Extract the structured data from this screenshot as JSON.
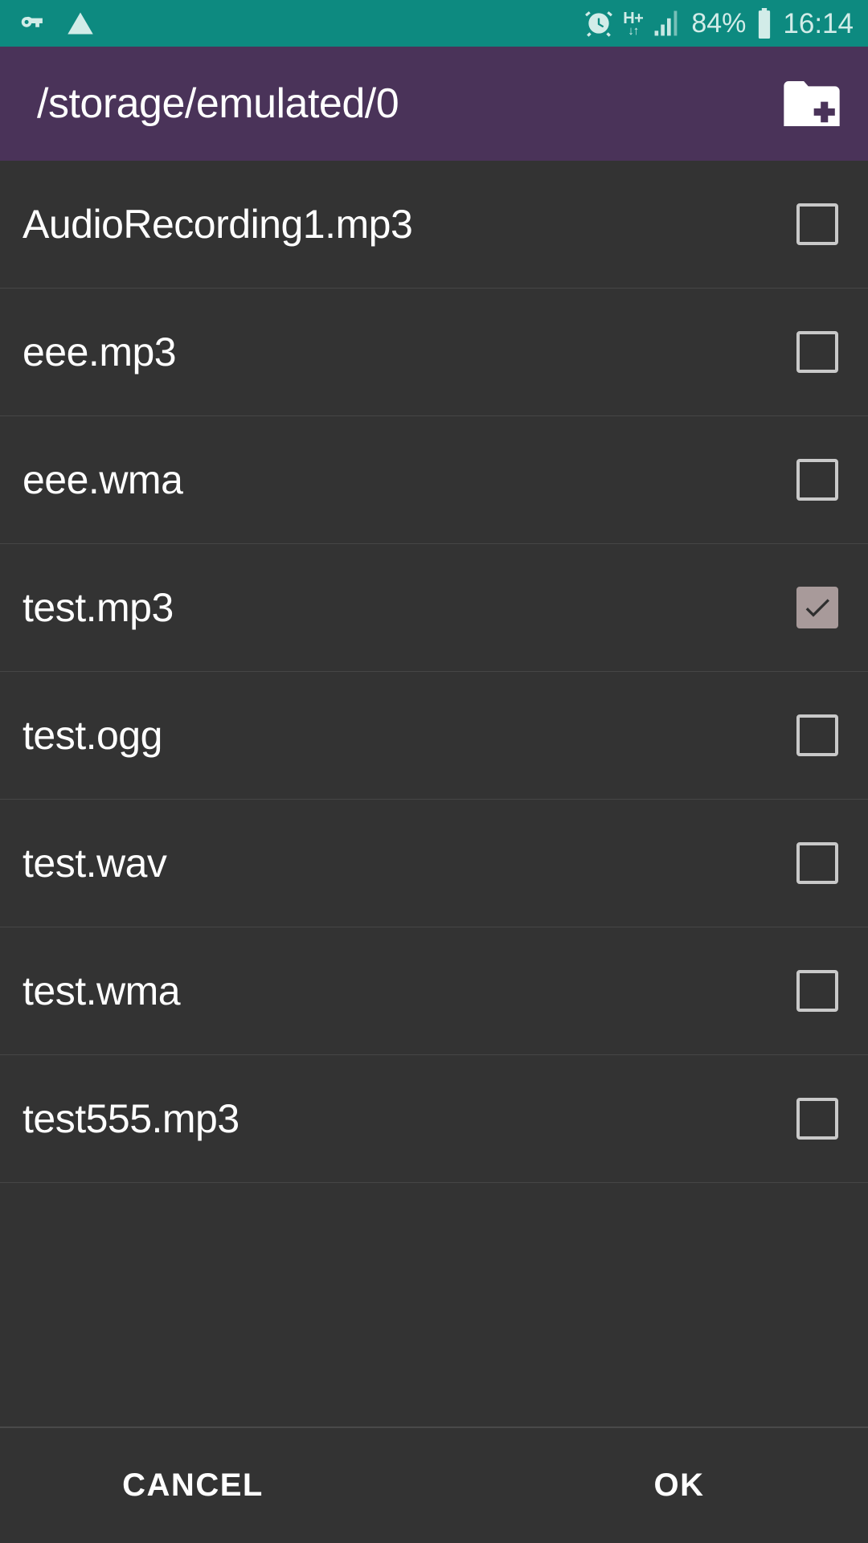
{
  "status_bar": {
    "background_color": "#0d8a80",
    "foreground_color": "#d2ece8",
    "left_icons": [
      {
        "name": "vpn-key-icon",
        "label": "VPN key"
      },
      {
        "name": "warning-triangle-icon",
        "label": "Warning"
      }
    ],
    "alarm_icon": "alarm-clock-icon",
    "network_type": "H+",
    "data_arrows": "↓↑",
    "signal_icon": "signal-bars-icon",
    "battery_percent": "84%",
    "battery_icon": "battery-icon",
    "clock": "16:14"
  },
  "header": {
    "background_color": "#4a3359",
    "path": "/storage/emulated/0",
    "action_icon": "create-new-folder-icon",
    "action_label": "Create new folder"
  },
  "file_list": {
    "background_color": "#333333",
    "divider_color": "#464646",
    "checkbox_checked_color": "#a89a9a",
    "checkbox_unchecked_color": "#c9c9c9",
    "items": [
      {
        "name": "AudioRecording1.mp3",
        "checked": false
      },
      {
        "name": "eee.mp3",
        "checked": false
      },
      {
        "name": "eee.wma",
        "checked": false
      },
      {
        "name": "test.mp3",
        "checked": true
      },
      {
        "name": "test.ogg",
        "checked": false
      },
      {
        "name": "test.wav",
        "checked": false
      },
      {
        "name": "test.wma",
        "checked": false
      },
      {
        "name": "test555.mp3",
        "checked": false
      }
    ]
  },
  "bottom_bar": {
    "cancel_label": "CANCEL",
    "ok_label": "OK"
  }
}
